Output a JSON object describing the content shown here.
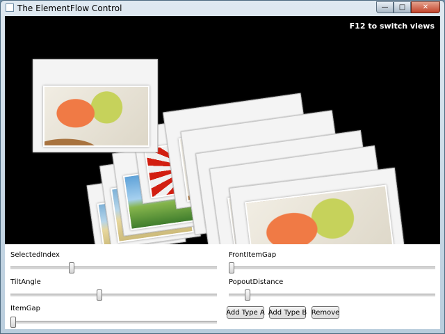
{
  "window": {
    "title": "The ElementFlow Control",
    "icons": {
      "app": "window-app-icon",
      "minimize": "minimize-icon",
      "maximize": "maximize-icon",
      "close": "close-icon"
    },
    "caption_glyphs": {
      "minimize": "—",
      "maximize": "□",
      "close": "✕"
    }
  },
  "stage": {
    "hint": "F12 to switch views",
    "image_kinds": [
      "paint",
      "flower",
      "sky",
      "sand"
    ]
  },
  "controls": {
    "selected_index": {
      "label": "SelectedIndex",
      "value_fraction": 0.29
    },
    "tilt_angle": {
      "label": "TiltAngle",
      "value_fraction": 0.43
    },
    "item_gap": {
      "label": "ItemGap",
      "value_fraction": 0.0
    },
    "front_item_gap": {
      "label": "FrontItemGap",
      "value_fraction": 0.0
    },
    "popout_distance": {
      "label": "PopoutDistance",
      "value_fraction": 0.08
    },
    "buttons": {
      "add_type_a": "Add Type A",
      "add_type_b": "Add Type B",
      "remove": "Remove"
    }
  }
}
